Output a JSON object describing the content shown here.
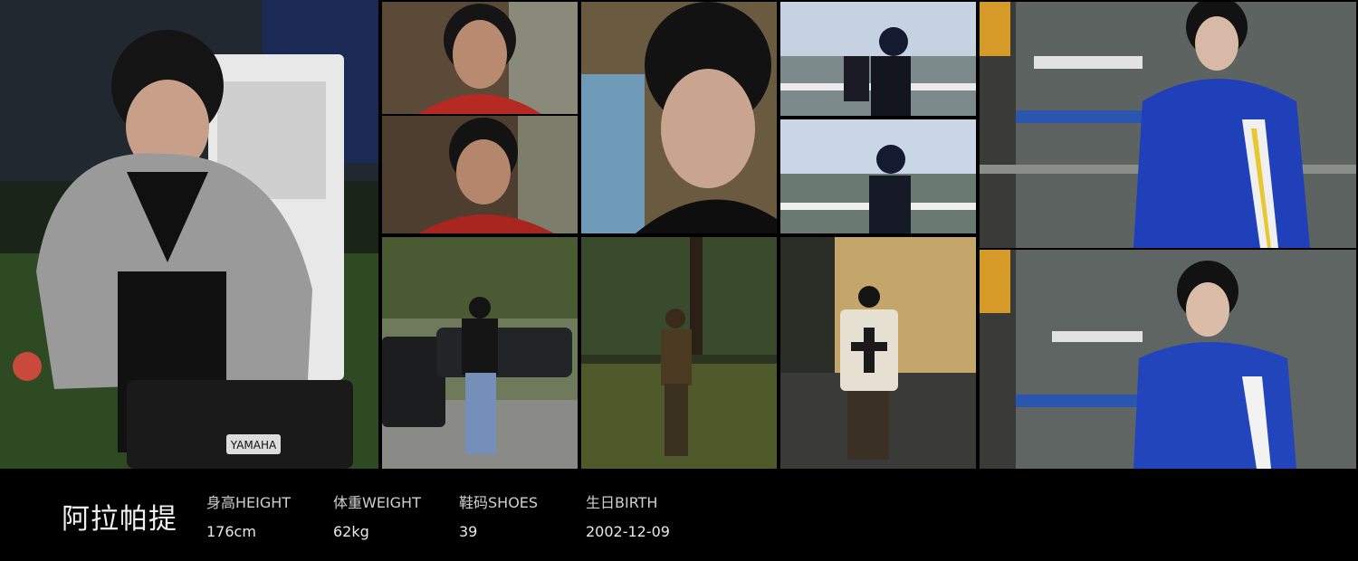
{
  "profile": {
    "name": "阿拉帕提",
    "stats": [
      {
        "label": "身高HEIGHT",
        "value": "176cm"
      },
      {
        "label": "体重WEIGHT",
        "value": "62kg"
      },
      {
        "label": "鞋码SHOES",
        "value": "39"
      },
      {
        "label": "生日BIRTH",
        "value": "2002-12-09"
      }
    ]
  },
  "photos": {
    "yamaha_text": "YAMAHA"
  }
}
